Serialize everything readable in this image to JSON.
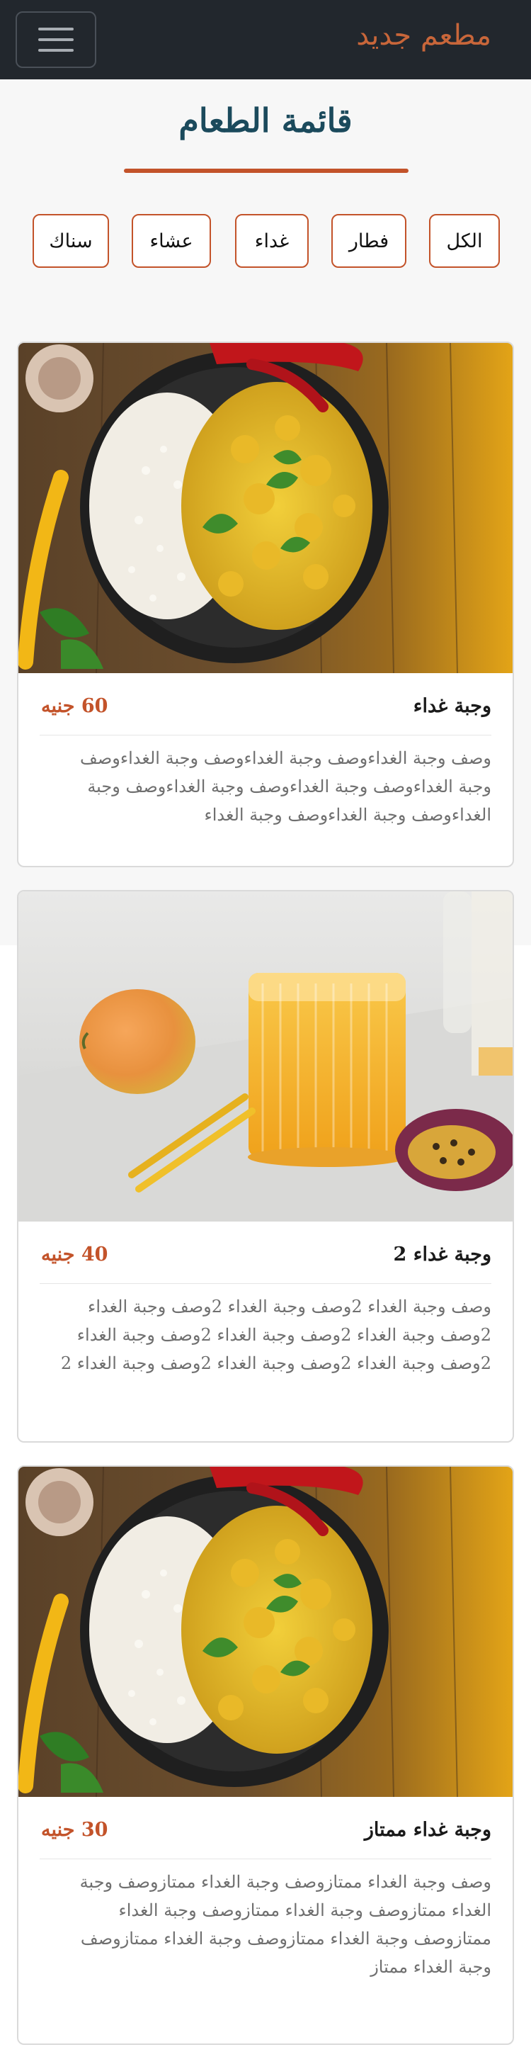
{
  "navbar": {
    "brand": "مطعم جديد",
    "toggle_icon": "hamburger-icon"
  },
  "menu": {
    "title": "قائمة الطعام",
    "filters": [
      "الكل",
      "فطار",
      "غداء",
      "عشاء",
      "سناك"
    ]
  },
  "items": [
    {
      "name": "وجبة غداء",
      "price": "60 جنيه",
      "description": "وصف وجبة الغداءوصف وجبة الغداءوصف وجبة الغداءوصف وجبة الغداءوصف وجبة الغداءوصف وجبة الغداءوصف وجبة الغداءوصف وجبة الغداءوصف وجبة الغداء",
      "image": "curry-rice-bowl-photo"
    },
    {
      "name": "وجبة غداء 2",
      "price": "40 جنيه",
      "description": "وصف وجبة الغداء 2وصف وجبة الغداء 2وصف وجبة الغداء 2وصف وجبة الغداء 2وصف وجبة الغداء 2وصف وجبة الغداء 2وصف وجبة الغداء 2وصف وجبة الغداء 2وصف وجبة الغداء 2",
      "image": "mango-juice-glass-photo"
    },
    {
      "name": "وجبة غداء ممتاز",
      "price": "30 جنيه",
      "description": "وصف وجبة الغداء ممتازوصف وجبة الغداء ممتازوصف وجبة الغداء ممتازوصف وجبة الغداء ممتازوصف وجبة الغداء ممتازوصف وجبة الغداء ممتازوصف وجبة الغداء ممتازوصف وجبة الغداء ممتاز",
      "image": "curry-rice-bowl-photo"
    }
  ],
  "colors": {
    "navbar_bg": "#22272d",
    "brand": "#c8663a",
    "accent": "#c3532a",
    "title": "#1b4a5c"
  }
}
